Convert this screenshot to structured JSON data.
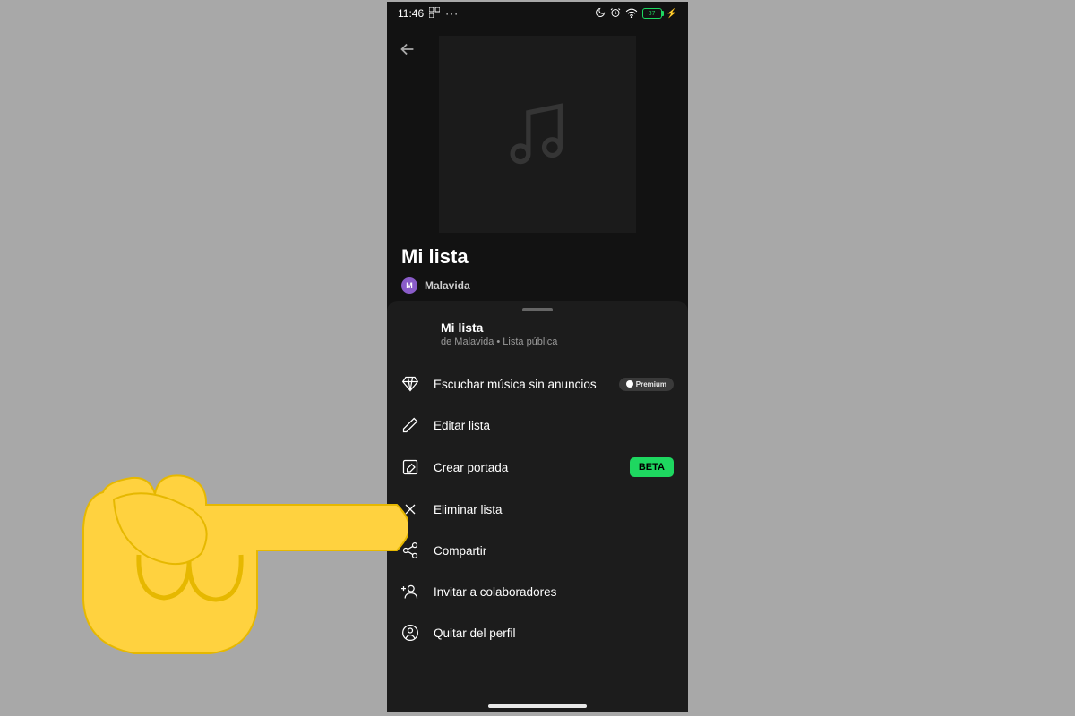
{
  "status": {
    "time": "11:46",
    "battery_text": "87"
  },
  "playlist": {
    "title": "Mi lista",
    "owner": "Malavida",
    "owner_initial": "M"
  },
  "sheet": {
    "title": "Mi lista",
    "subtitle": "de Malavida • Lista pública"
  },
  "menu": {
    "listen_no_ads": "Escuchar música sin anuncios",
    "premium_label": "Premium",
    "edit_list": "Editar lista",
    "create_cover": "Crear portada",
    "beta_label": "BETA",
    "delete_list": "Eliminar lista",
    "share": "Compartir",
    "invite": "Invitar a colaboradores",
    "remove_profile": "Quitar del perfil"
  }
}
